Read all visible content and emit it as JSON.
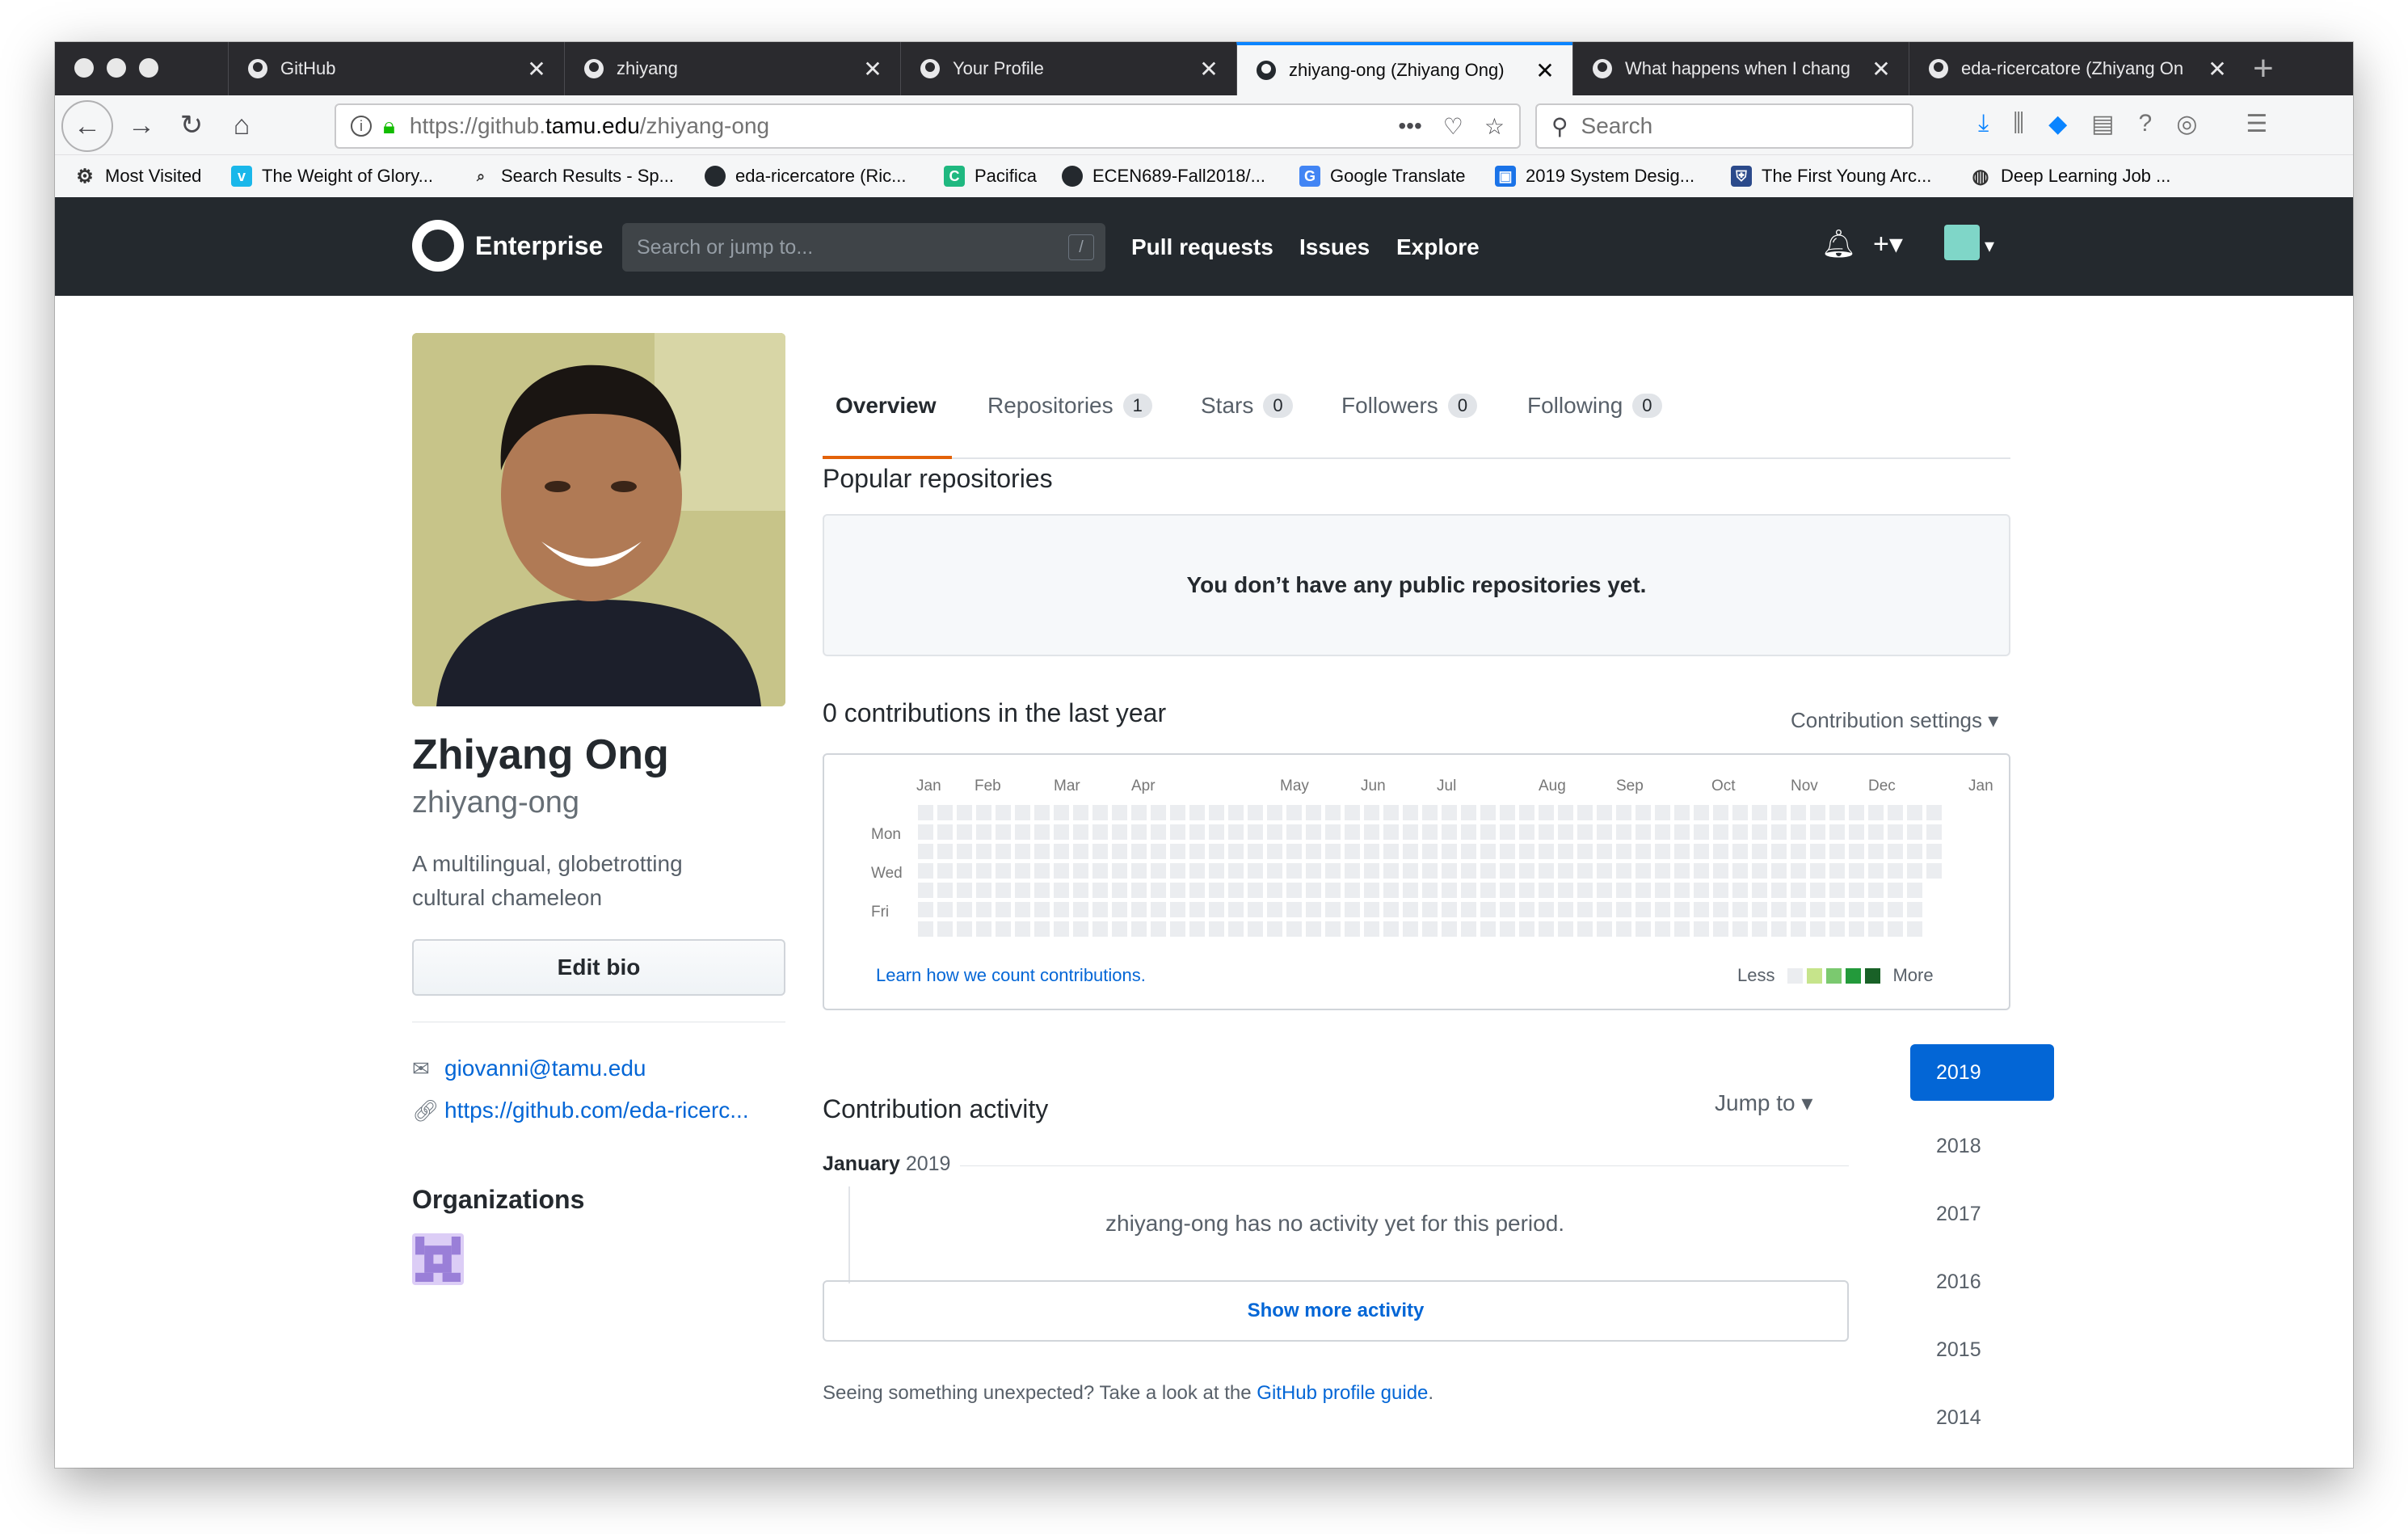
{
  "browser": {
    "tabs": [
      {
        "label": "GitHub",
        "active": false
      },
      {
        "label": "zhiyang",
        "active": false
      },
      {
        "label": "Your Profile",
        "active": false
      },
      {
        "label": "zhiyang-ong (Zhiyang Ong)",
        "active": true
      },
      {
        "label": "What happens when I chang",
        "active": false
      },
      {
        "label": "eda-ricercatore (Zhiyang On",
        "active": false
      }
    ],
    "url_prefix": "https://github.",
    "url_domain": "tamu.edu",
    "url_path": "/zhiyang-ong",
    "search_placeholder": "Search",
    "bookmarks": [
      {
        "label": "Most Visited",
        "icon": "gear-icon"
      },
      {
        "label": "The Weight of Glory...",
        "icon": "vimeo-icon"
      },
      {
        "label": "Search Results - Sp...",
        "icon": "search-results-icon"
      },
      {
        "label": "eda-ricercatore (Ric...",
        "icon": "github-icon"
      },
      {
        "label": "Pacifica",
        "icon": "pacifica-icon"
      },
      {
        "label": "ECEN689-Fall2018/...",
        "icon": "github-icon"
      },
      {
        "label": "Google Translate",
        "icon": "translate-icon"
      },
      {
        "label": "2019 System Desig...",
        "icon": "system-design-icon"
      },
      {
        "label": "The First Young Arc...",
        "icon": "shield-icon"
      },
      {
        "label": "Deep Learning Job ...",
        "icon": "globe-icon"
      }
    ]
  },
  "github": {
    "brand": "Enterprise",
    "search_placeholder": "Search or jump to...",
    "slash_hint": "/",
    "nav": [
      "Pull requests",
      "Issues",
      "Explore"
    ]
  },
  "profile": {
    "name": "Zhiyang Ong",
    "login": "zhiyang-ong",
    "bio_line1": "A multilingual, globetrotting",
    "bio_line2": "cultural chameleon",
    "edit_bio": "Edit bio",
    "email": "giovanni@tamu.edu",
    "website": "https://github.com/eda-ricerc...",
    "orgs_title": "Organizations"
  },
  "tabs": [
    {
      "label": "Overview",
      "count": null
    },
    {
      "label": "Repositories",
      "count": "1"
    },
    {
      "label": "Stars",
      "count": "0"
    },
    {
      "label": "Followers",
      "count": "0"
    },
    {
      "label": "Following",
      "count": "0"
    }
  ],
  "popular": {
    "title": "Popular repositories",
    "empty_message": "You don’t have any public repositories yet."
  },
  "contributions": {
    "title": "0 contributions in the last year",
    "settings": "Contribution settings",
    "months": [
      "Jan",
      "Feb",
      "Mar",
      "Apr",
      "May",
      "Jun",
      "Jul",
      "Aug",
      "Sep",
      "Oct",
      "Nov",
      "Dec",
      "Jan"
    ],
    "weekdays": [
      "Mon",
      "Wed",
      "Fri"
    ],
    "learn_link": "Learn how we count contributions.",
    "legend_less": "Less",
    "legend_more": "More",
    "legend_colors": [
      "#ebedf0",
      "#c6e48b",
      "#7bc96f",
      "#239a3b",
      "#196127"
    ]
  },
  "activity": {
    "title": "Contribution activity",
    "jump_to": "Jump to",
    "period_month": "January",
    "period_year": "2019",
    "no_activity": "zhiyang-ong has no activity yet for this period.",
    "show_more": "Show more activity",
    "guide_text": "Seeing something unexpected? Take a look at the",
    "guide_link": "GitHub profile guide",
    "guide_end": ".",
    "years": [
      "2019",
      "2018",
      "2017",
      "2016",
      "2015",
      "2014"
    ]
  }
}
